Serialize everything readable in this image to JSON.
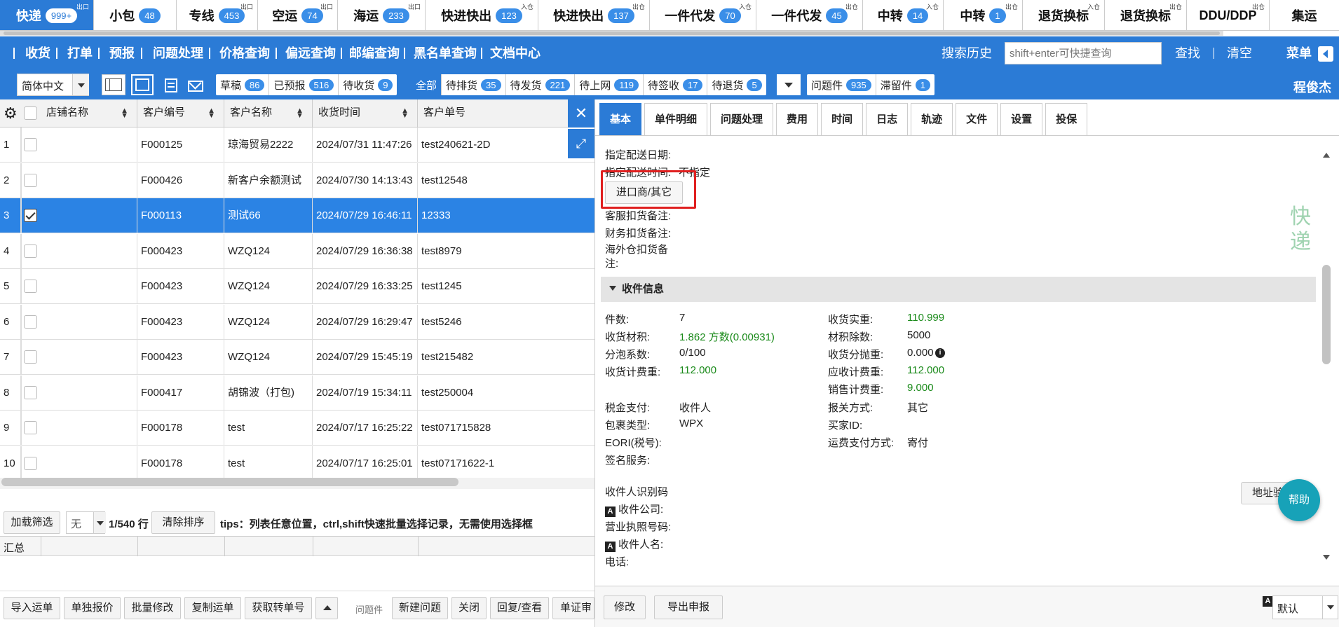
{
  "product_tabs": [
    {
      "label": "快递",
      "badge": "999+",
      "tag": "出口",
      "active": true,
      "w": 134
    },
    {
      "label": "小包",
      "badge": "48",
      "tag": "",
      "active": false,
      "w": 118
    },
    {
      "label": "专线",
      "badge": "453",
      "tag": "出口",
      "active": false,
      "w": 116
    },
    {
      "label": "空运",
      "badge": "74",
      "tag": "出口",
      "active": false,
      "w": 114
    },
    {
      "label": "海运",
      "badge": "233",
      "tag": "出口",
      "active": false,
      "w": 125
    },
    {
      "label": "快进快出",
      "badge": "123",
      "tag": "入仓",
      "active": false,
      "w": 161
    },
    {
      "label": "快进快出",
      "badge": "137",
      "tag": "出仓",
      "active": false,
      "w": 159
    },
    {
      "label": "一件代发",
      "badge": "70",
      "tag": "入仓",
      "active": false,
      "w": 152
    },
    {
      "label": "一件代发",
      "badge": "45",
      "tag": "出仓",
      "active": false,
      "w": 152
    },
    {
      "label": "中转",
      "badge": "14",
      "tag": "入仓",
      "active": false,
      "w": 115
    },
    {
      "label": "中转",
      "badge": "1",
      "tag": "出仓",
      "active": false,
      "w": 113
    },
    {
      "label": "退货换标",
      "badge": "",
      "tag": "入仓",
      "active": false,
      "w": 117
    },
    {
      "label": "退货换标",
      "badge": "",
      "tag": "出仓",
      "active": false,
      "w": 117
    },
    {
      "label": "DDU/DDP",
      "badge": "",
      "tag": "出仓",
      "active": false,
      "w": 118
    },
    {
      "label": "集运",
      "badge": "",
      "tag": "",
      "active": false,
      "w": 100
    }
  ],
  "nav": {
    "items": [
      "收货",
      "打单",
      "预报",
      "问题处理",
      "价格查询",
      "偏远查询",
      "邮编查询",
      "黑名单查询",
      "文档中心"
    ],
    "search_history": "搜索历史",
    "search_placeholder": "shift+enter可快捷查询",
    "find": "查找",
    "clear": "清空",
    "menu": "菜单"
  },
  "filter": {
    "language": "简体中文",
    "group1": [
      {
        "label": "草稿",
        "badge": "86"
      },
      {
        "label": "已预报",
        "badge": "516"
      },
      {
        "label": "待收货",
        "badge": "9"
      }
    ],
    "group2": [
      {
        "label": "全部",
        "badge": "",
        "active": true
      },
      {
        "label": "待排货",
        "badge": "35"
      },
      {
        "label": "待发货",
        "badge": "221"
      },
      {
        "label": "待上网",
        "badge": "119"
      },
      {
        "label": "待签收",
        "badge": "17"
      },
      {
        "label": "待退货",
        "badge": "5"
      }
    ],
    "group3": [
      {
        "label": "问题件",
        "badge": "935"
      },
      {
        "label": "滞留件",
        "badge": "1"
      }
    ],
    "user": "程俊杰"
  },
  "grid": {
    "headers": [
      "店铺名称",
      "客户编号",
      "客户名称",
      "收货时间",
      "客户单号"
    ],
    "rows": [
      {
        "no": "1",
        "checked": false,
        "code": "F000125",
        "name": "琼海贸易2222",
        "time": "2024/07/31 11:47:26",
        "order": "test240621-2D"
      },
      {
        "no": "2",
        "checked": false,
        "code": "F000426",
        "name": "新客户余额测试",
        "time": "2024/07/30 14:13:43",
        "order": "test12548"
      },
      {
        "no": "3",
        "checked": true,
        "code": "F000113",
        "name": "测试66",
        "time": "2024/07/29 16:46:11",
        "order": "12333"
      },
      {
        "no": "4",
        "checked": false,
        "code": "F000423",
        "name": "WZQ124",
        "time": "2024/07/29 16:36:38",
        "order": "test8979"
      },
      {
        "no": "5",
        "checked": false,
        "code": "F000423",
        "name": "WZQ124",
        "time": "2024/07/29 16:33:25",
        "order": "test1245"
      },
      {
        "no": "6",
        "checked": false,
        "code": "F000423",
        "name": "WZQ124",
        "time": "2024/07/29 16:29:47",
        "order": "test5246"
      },
      {
        "no": "7",
        "checked": false,
        "code": "F000423",
        "name": "WZQ124",
        "time": "2024/07/29 15:45:19",
        "order": "test215482"
      },
      {
        "no": "8",
        "checked": false,
        "code": "F000417",
        "name": "胡锦波（打包)",
        "time": "2024/07/19 15:34:11",
        "order": "test250004"
      },
      {
        "no": "9",
        "checked": false,
        "code": "F000178",
        "name": "test",
        "time": "2024/07/17 16:25:22",
        "order": "test071715828"
      },
      {
        "no": "10",
        "checked": false,
        "code": "F000178",
        "name": "test",
        "time": "2024/07/17 16:25:01",
        "order": "test07171622-1"
      }
    ]
  },
  "pager": {
    "load_filter": "加载筛选",
    "none": "无",
    "count": "1/540 行",
    "clear_sort": "清除排序",
    "tips": "tips：列表任意位置，ctrl,shift快速批量选择记录，无需使用选择框",
    "summary": "汇总"
  },
  "bottom_actions": [
    "导入运单",
    "单独报价",
    "批量修改",
    "复制运单",
    "获取转单号"
  ],
  "issue_label": "问题件",
  "issue_actions": [
    "新建问题",
    "关闭",
    "回复/查看",
    "单证审"
  ],
  "detail": {
    "tabs": [
      "基本",
      "单件明细",
      "问题处理",
      "费用",
      "时间",
      "日志",
      "轨迹",
      "文件",
      "设置",
      "投保"
    ],
    "delivery_date_label": "指定配送日期:",
    "delivery_time_label": "指定配送时间:",
    "delivery_time_value": "不指定",
    "importer_button": "进口商/其它",
    "cs_note_label": "客服扣货备注:",
    "fin_note_label": "财务扣货备注:",
    "overseas_note_label1": "海外仓扣货备",
    "overseas_note_label2": "注:",
    "stamp_line1": "快",
    "stamp_line2": "递",
    "section_title": "收件信息",
    "fields_left": [
      {
        "label": "件数:",
        "value": "7",
        "green": false
      },
      {
        "label": "收货材积:",
        "value": "1.862 方数(0.00931)",
        "green": true
      },
      {
        "label": "分泡系数:",
        "value": "0/100",
        "green": false
      },
      {
        "label": "收货计费重:",
        "value": "112.000",
        "green": true
      }
    ],
    "fields_right": [
      {
        "label": "收货实重:",
        "value": "110.999",
        "green": true
      },
      {
        "label": "材积除数:",
        "value": "5000",
        "green": false
      },
      {
        "label": "收货分抛重:",
        "value": "0.000",
        "green": false
      },
      {
        "label": "应收计费重:",
        "value": "112.000",
        "green": true
      },
      {
        "label": "销售计费重:",
        "value": "9.000",
        "green": true
      }
    ],
    "tax_label": "税金支付:",
    "tax_value": "收件人",
    "pkg_label": "包裹类型:",
    "pkg_value": "WPX",
    "eori_label": "EORI(税号):",
    "sign_label": "签名服务:",
    "customs_label": "报关方式:",
    "customs_value": "其它",
    "buyer_label": "买家ID:",
    "freight_label": "运费支付方式:",
    "freight_value": "寄付",
    "recipient_id_label": "收件人识别码",
    "company_label": "收件公司:",
    "license_label": "营业执照号码:",
    "recipient_name_label": "收件人名:",
    "phone_label": "电话:",
    "address_check": "地址验",
    "help": "帮助",
    "edit": "修改",
    "export": "导出申报",
    "default_select": "默认"
  }
}
